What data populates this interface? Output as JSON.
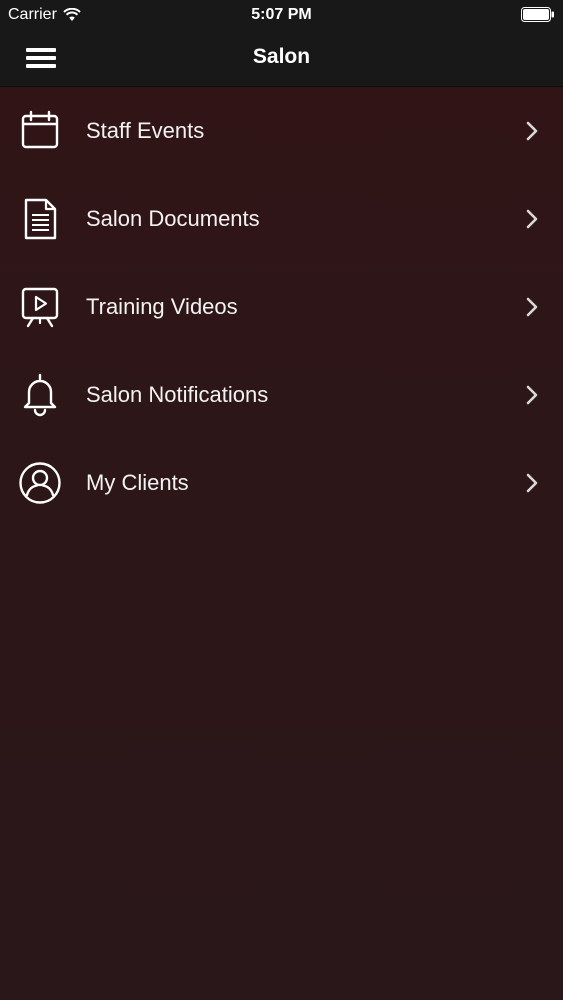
{
  "status_bar": {
    "carrier": "Carrier",
    "time": "5:07 PM"
  },
  "nav_bar": {
    "title": "Salon",
    "menu_icon": "hamburger-menu-icon"
  },
  "menu": {
    "items": [
      {
        "label": "Staff Events",
        "icon": "calendar-icon"
      },
      {
        "label": "Salon Documents",
        "icon": "document-icon"
      },
      {
        "label": "Training Videos",
        "icon": "video-presentation-icon"
      },
      {
        "label": "Salon Notifications",
        "icon": "bell-icon"
      },
      {
        "label": "My Clients",
        "icon": "user-circle-icon"
      }
    ]
  },
  "colors": {
    "background": "#2f1517",
    "bars": "#181818",
    "text": "#ffffff"
  }
}
